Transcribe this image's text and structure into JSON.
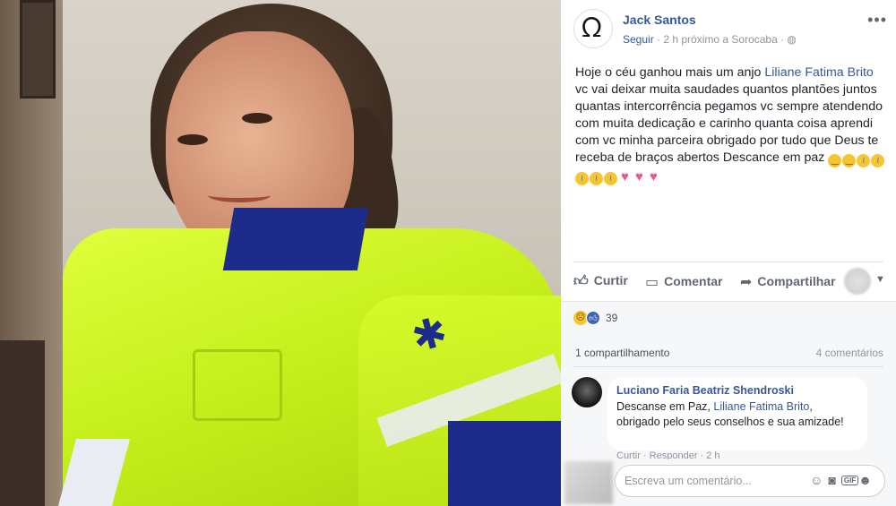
{
  "post": {
    "author": "Jack Santos",
    "follow": "Seguir",
    "time_location": " · 2 h próximo a Sorocaba · ",
    "globe_icon": "globe-icon",
    "more_icon": "more-options-icon",
    "text_before": "Hoje o céu ganhou mais um anjo ",
    "mention": "Liliane Fatima Brito",
    "text_after": " vc vai deixar muita saudades quantos plantões juntos quantas intercorrência pegamos vc sempre atendendo com muita dedicação e carinho quanta coisa aprendi com vc minha parceira obrigado por tudo que Deus te receba de braços abertos Descance em paz "
  },
  "actions": {
    "like": "Curtir",
    "comment": "Comentar",
    "share": "Compartilhar"
  },
  "reactions": {
    "count": "39"
  },
  "stats": {
    "shares": "1 compartilhamento",
    "comments": "4 comentários"
  },
  "comment": {
    "author": "Luciano Faria Beatriz Shendroski",
    "text_before": "Descanse em Paz, ",
    "mention": "Liliane Fatima Brito",
    "text_after": ", obrigado pelo seus conselhos e sua amizade!",
    "actions": "Curtir · Responder · 2 h"
  },
  "write_comment": {
    "placeholder": "Escreva um comentário..."
  },
  "colors": {
    "link": "#365899",
    "jacket": "#c4ee1a"
  }
}
